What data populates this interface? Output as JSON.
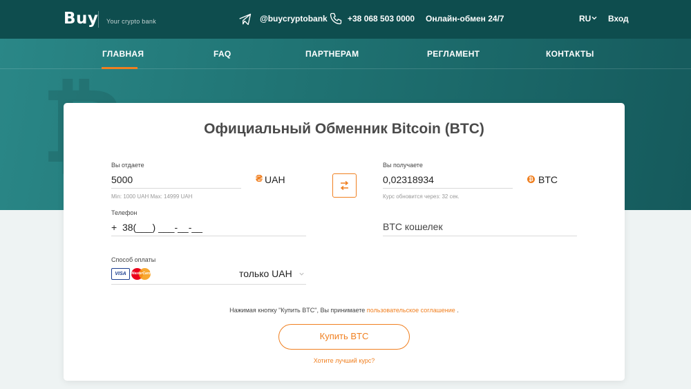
{
  "header": {
    "logo": "Buy",
    "tagline": "Your crypto bank",
    "telegram": "@buycryptobank",
    "phone": "+38 068 503 0000",
    "online_exchange": "Онлайн-обмен 24/7",
    "language": "RU",
    "login": "Вход",
    "background_color": "#0e4d4e"
  },
  "nav": {
    "items": [
      {
        "label": "ГЛАВНАЯ",
        "active": true
      },
      {
        "label": "FAQ",
        "active": false
      },
      {
        "label": "ПАРТНЕРАМ",
        "active": false
      },
      {
        "label": "РЕГЛАМЕНТ",
        "active": false
      },
      {
        "label": "КОНТАКТЫ",
        "active": false
      }
    ],
    "active_color": "#f07f1f"
  },
  "exchange": {
    "title": "Официальный Обменник Bitcoin (BTC)",
    "give": {
      "label": "Вы отдаете",
      "value": "5000",
      "currency": "UAH",
      "currency_icon": "hryvnia-icon",
      "hint": "Min: 1000 UAH Max: 14999 UAH"
    },
    "receive": {
      "label": "Вы получаете",
      "value": "0,02318934",
      "currency": "BTC",
      "currency_icon": "bitcoin-icon",
      "hint": "Курс обновится через: 32 сек."
    },
    "phone": {
      "label": "Телефон",
      "value": "+  38(___) ___-__-__"
    },
    "wallet": {
      "placeholder": "BTC кошелек"
    },
    "payment": {
      "label": "Способ оплаты",
      "selected": "только UAH",
      "card_visa": "VISA",
      "card_mastercard": "MasterCard"
    },
    "agreement_text": "Нажимая кнопку \"Купить BTC\", Вы принимаете",
    "agreement_link": "пользовательское соглашение",
    "agreement_end": " .",
    "buy_button": "Купить BTC",
    "better_rate_link": "Хотите лучший курс?",
    "accent_color": "#f07f1f"
  }
}
